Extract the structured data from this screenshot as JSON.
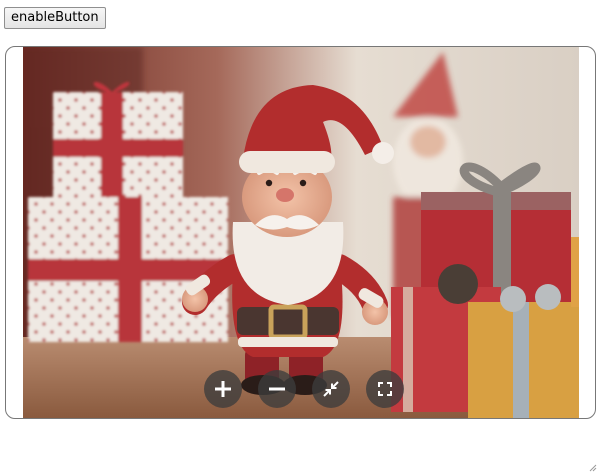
{
  "enable_button": {
    "label": "enableButton"
  },
  "viewer": {
    "image_subject": "santa-figurine-with-gift-boxes",
    "toolbar": [
      {
        "name": "zoom-in",
        "icon": "plus-icon"
      },
      {
        "name": "zoom-out",
        "icon": "minus-icon"
      },
      {
        "name": "exit-fullscreen",
        "icon": "collapse-arrows-icon"
      },
      {
        "name": "fullscreen",
        "icon": "expand-corners-icon"
      }
    ]
  },
  "colors": {
    "toolbar_button_bg": "#3c3c3c",
    "santa_red": "#b22d2d",
    "background_wall": "#e6ddd2"
  }
}
